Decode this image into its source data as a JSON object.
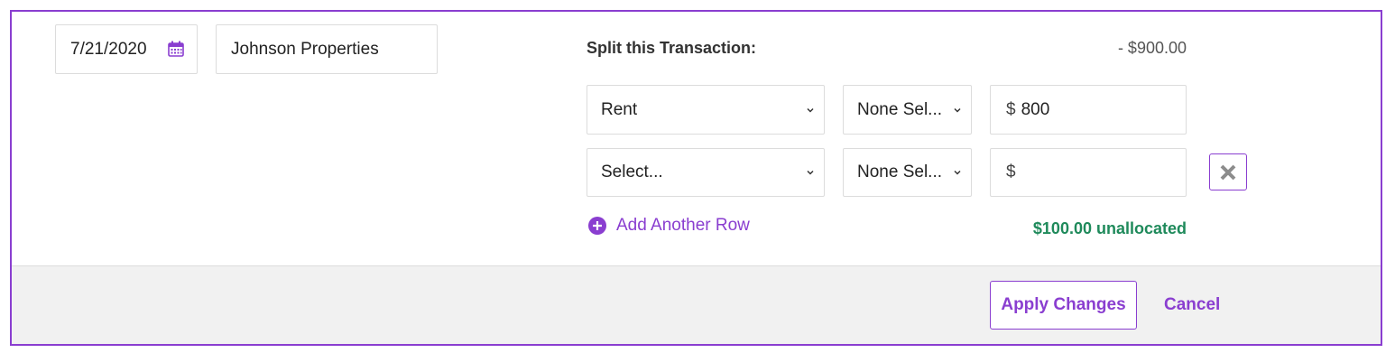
{
  "transaction": {
    "date": "7/21/2020",
    "payee": "Johnson Properties"
  },
  "split": {
    "label": "Split this Transaction:",
    "total": "- $900.00",
    "rows": [
      {
        "category": "Rent",
        "class": "None Sel...",
        "currency": "$",
        "amount": "800"
      },
      {
        "category": "Select...",
        "class": "None Sel...",
        "currency": "$",
        "amount": ""
      }
    ],
    "add_row_label": "Add Another Row",
    "unallocated": "$100.00 unallocated"
  },
  "footer": {
    "apply_label": "Apply Changes",
    "cancel_label": "Cancel"
  },
  "colors": {
    "accent": "#8a3ed0",
    "success": "#1f8a5b",
    "footer_bg": "#f1f1f1"
  },
  "icons": [
    "calendar-icon",
    "chevron-down-icon",
    "remove-icon",
    "add-circle-icon"
  ]
}
